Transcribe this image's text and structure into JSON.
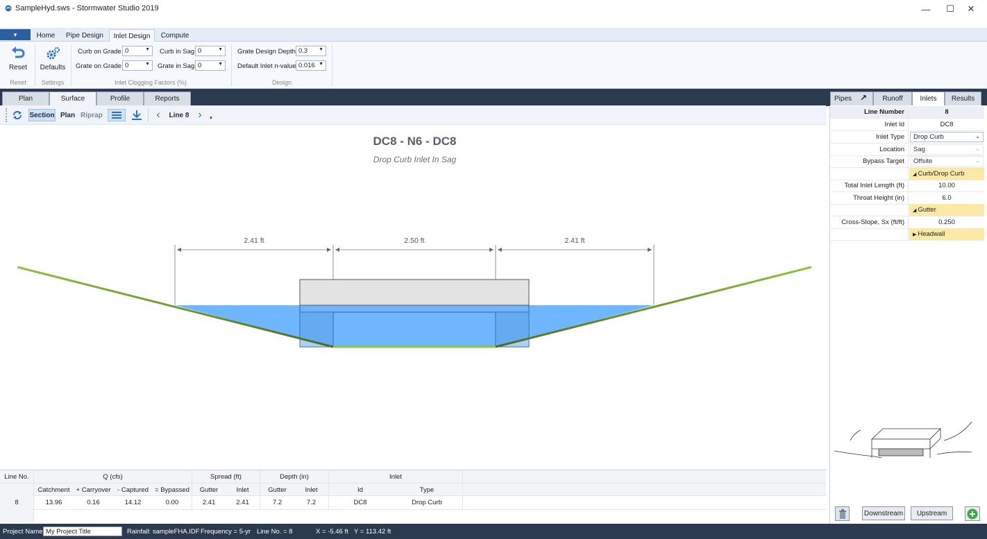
{
  "window": {
    "title": "SampleHyd.sws - Stormwater Studio 2019",
    "controls": {
      "minimize": "—",
      "maximize": "☐",
      "close": "✕"
    }
  },
  "ribbon": {
    "tabs": [
      {
        "label": "Home"
      },
      {
        "label": "Pipe Design"
      },
      {
        "label": "Inlet Design"
      },
      {
        "label": "Compute"
      }
    ],
    "reset_label": "Reset",
    "defaults_label": "Defaults",
    "groups": {
      "reset": "Reset",
      "settings": "Settings",
      "clogging": "Inlet Clogging Factors (%)",
      "design": "Design"
    },
    "clogging": {
      "curb_on_grade": {
        "label": "Curb on Grade",
        "value": "0"
      },
      "grate_on_grade": {
        "label": "Grate on Grade",
        "value": "0"
      },
      "curb_in_sag": {
        "label": "Curb in Sag",
        "value": "0"
      },
      "grate_in_sag": {
        "label": "Grate in Sag",
        "value": "0"
      }
    },
    "design": {
      "grate_depth": {
        "label": "Grate Design Depth",
        "value": "0.3"
      },
      "inlet_n": {
        "label": "Default Inlet n-value",
        "value": "0.016"
      }
    }
  },
  "view_tabs": [
    {
      "label": "Plan"
    },
    {
      "label": "Surface"
    },
    {
      "label": "Profile"
    },
    {
      "label": "Reports"
    }
  ],
  "toolbar": {
    "section": "Section",
    "plan": "Plan",
    "riprap": "Riprap",
    "line": "Line 8"
  },
  "drawing": {
    "title": "DC8 - N6 - DC8",
    "subtitle": "Drop Curb Inlet In Sag",
    "dims": [
      "2.41 ft",
      "2.50 ft",
      "2.41 ft"
    ]
  },
  "table": {
    "line_no_header": "Line No.",
    "groups": {
      "q": "Q (cfs)",
      "spread": "Spread (ft)",
      "depth": "Depth (in)",
      "inlet": "Inlet"
    },
    "columns": [
      "Catchment",
      "+ Carryover",
      "- Captured",
      "= Bypassed",
      "Gutter",
      "Inlet",
      "Gutter",
      "Inlet",
      "Id",
      "Type"
    ],
    "row": {
      "line": "8",
      "cells": [
        "13.96",
        "0.16",
        "14.12",
        "0.00",
        "2.41",
        "2.41",
        "7.2",
        "7.2",
        "DC8",
        "Drop Curb"
      ]
    }
  },
  "panel": {
    "tabs": [
      {
        "label": "Pipes"
      },
      {
        "label": "Runoff"
      },
      {
        "label": "Inlets"
      },
      {
        "label": "Results"
      }
    ],
    "line_number": {
      "label": "Line Number",
      "value": "8"
    },
    "inlet_id": {
      "label": "Inlet Id",
      "value": "DC8"
    },
    "inlet_type": {
      "label": "Inlet Type",
      "value": "Drop Curb"
    },
    "location": {
      "label": "Location",
      "value": "Sag"
    },
    "bypass": {
      "label": "Bypass Target",
      "value": "Offsite"
    },
    "sec_curb": "Curb/Drop Curb",
    "total_len": {
      "label": "Total Inlet Length (ft)",
      "value": "10.00"
    },
    "throat": {
      "label": "Throat Height (in)",
      "value": "6.0"
    },
    "sec_gutter": "Gutter",
    "cross_slope": {
      "label": "Cross-Slope, Sx (ft/ft)",
      "value": "0.250"
    },
    "sec_headwall": "Headwall",
    "downstream": "Downstream",
    "upstream": "Upstream"
  },
  "status": {
    "project_label": "Project Name:",
    "project_value": "My Project Title",
    "rainfall": "Rainfall: sampleFHA.IDF",
    "frequency": "Frequency = 5-yr",
    "line_no": "Line No. = 8",
    "x": "X = -5.46 ft",
    "y": "Y = 113.42 ft"
  },
  "colors": {
    "water": "#6fb6ff",
    "ground_dark": "#5b7d2a",
    "ground_light": "#8cc63f",
    "status_bg": "#2b3a4f"
  }
}
